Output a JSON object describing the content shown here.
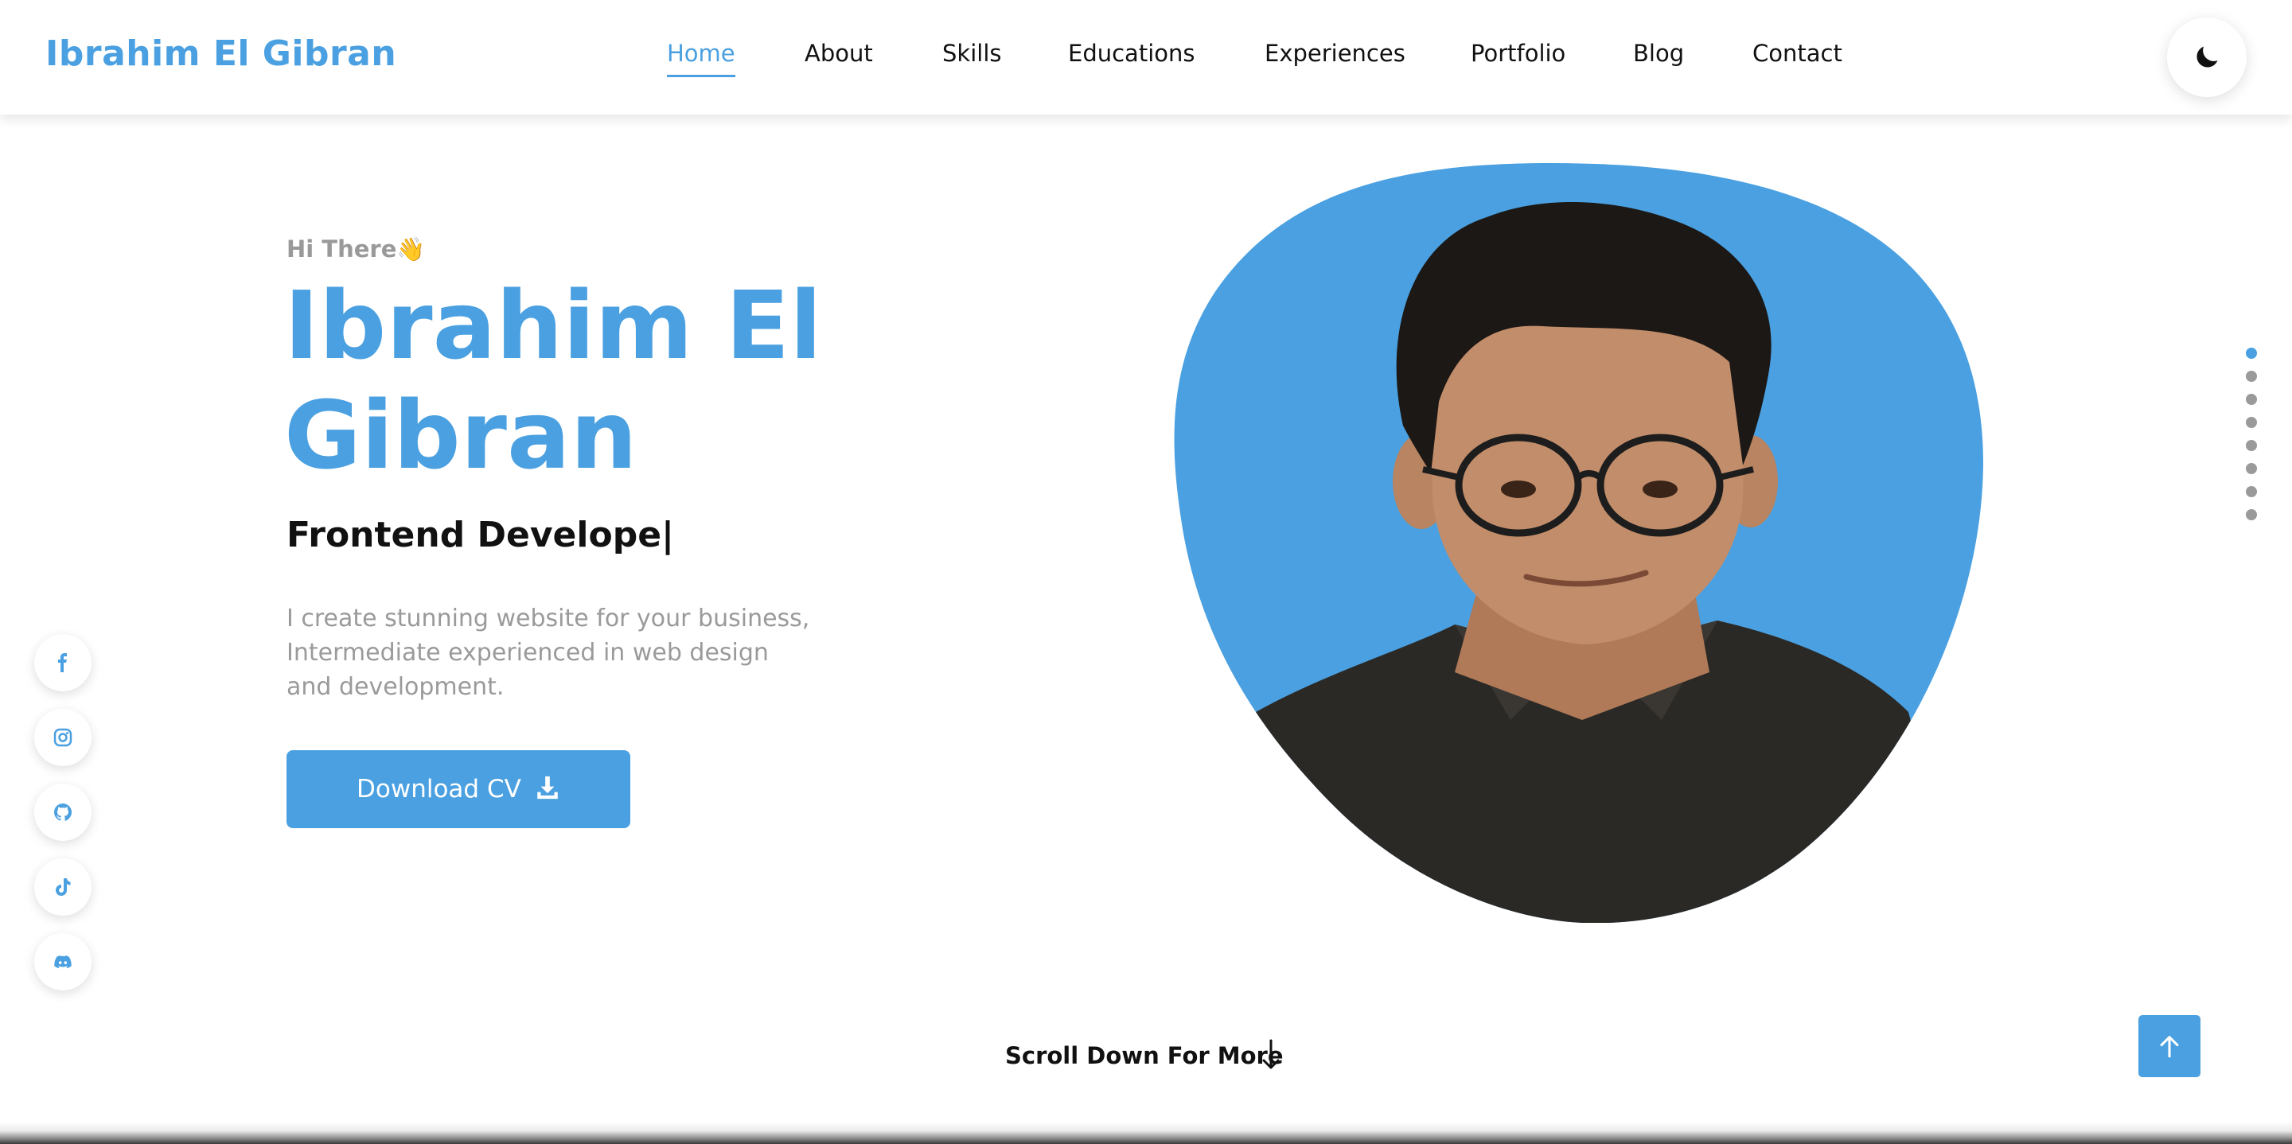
{
  "header": {
    "brand": "Ibrahim El Gibran",
    "nav": [
      "Home",
      "About",
      "Skills",
      "Educations",
      "Experiences",
      "Portfolio",
      "Blog",
      "Contact"
    ],
    "active_nav": "Home",
    "theme_icon": "moon-icon"
  },
  "hero": {
    "greeting": "Hi There👋",
    "name_line1": "Ibrahim El",
    "name_line2": "Gibran",
    "role": "Frontend Develope|",
    "description": "I create stunning website for your business, Intermediate experienced in web design and development.",
    "cv_button": "Download CV",
    "cv_icon": "download-icon"
  },
  "social_links": [
    "facebook-icon",
    "instagram-icon",
    "github-icon",
    "tiktok-icon",
    "discord-icon"
  ],
  "section_dots": {
    "count": 8,
    "active_index": 0
  },
  "scroll": {
    "label": "Scroll Down For More",
    "icon": "arrow-down-icon"
  },
  "back_to_top_icon": "arrow-up-icon",
  "colors": {
    "accent": "#4aa0e0",
    "text": "#111111",
    "muted": "#9a9a9a",
    "background": "#ffffff"
  }
}
